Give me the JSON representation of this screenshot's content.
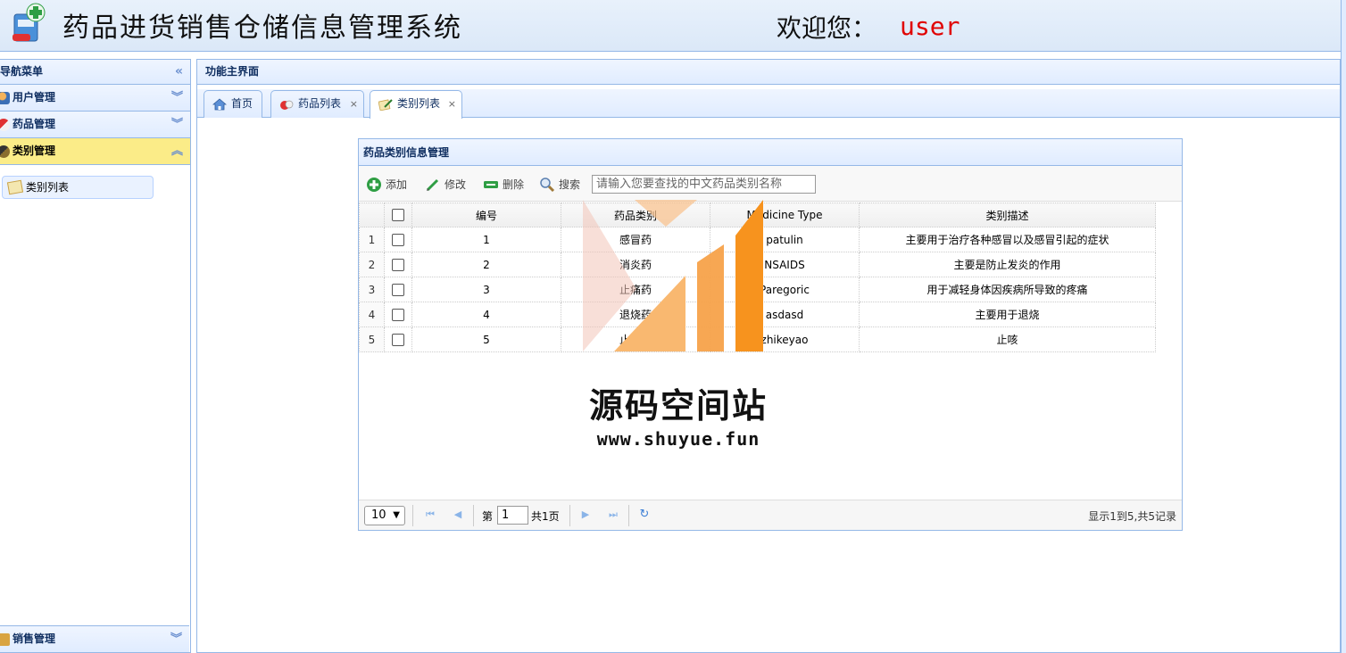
{
  "header": {
    "title": "药品进货销售仓储信息管理系统",
    "welcome": "欢迎您：",
    "username": "user"
  },
  "sidebar": {
    "title": "导航菜单",
    "sections": [
      {
        "label": "用户管理",
        "icon": "users-icon"
      },
      {
        "label": "药品管理",
        "icon": "pill-icon"
      },
      {
        "label": "类别管理",
        "icon": "category-icon"
      }
    ],
    "active_item": "类别列表",
    "bottom_section": "销售管理"
  },
  "main": {
    "title": "功能主界面",
    "tabs": [
      {
        "label": "首页",
        "icon": "home-icon"
      },
      {
        "label": "药品列表",
        "icon": "pill-icon"
      },
      {
        "label": "类别列表",
        "icon": "edit-icon"
      }
    ],
    "close_glyph": "×"
  },
  "grid": {
    "title": "药品类别信息管理",
    "toolbar": {
      "add": "添加",
      "edit": "修改",
      "delete": "删除",
      "search": "搜索",
      "search_placeholder": "请输入您要查找的中文药品类别名称"
    },
    "columns": [
      "编号",
      "药品类别",
      "Medicine Type",
      "类别描述"
    ],
    "rows": [
      {
        "n": "1",
        "id": "1",
        "category": "感冒药",
        "type": "patulin",
        "desc": "主要用于治疗各种感冒以及感冒引起的症状"
      },
      {
        "n": "2",
        "id": "2",
        "category": "消炎药",
        "type": "NSAIDS",
        "desc": "主要是防止发炎的作用"
      },
      {
        "n": "3",
        "id": "3",
        "category": "止痛药",
        "type": "Paregoric",
        "desc": "用于减轻身体因疾病所导致的疼痛"
      },
      {
        "n": "4",
        "id": "4",
        "category": "退烧药",
        "type": "asdasd",
        "desc": "主要用于退烧"
      },
      {
        "n": "5",
        "id": "5",
        "category": "止咳药",
        "type": "zhikeyao",
        "desc": "止咳"
      }
    ],
    "pager": {
      "page_size": "10",
      "page_prefix": "第",
      "page_number": "1",
      "page_total": "共1页",
      "info": "显示1到5,共5记录"
    }
  },
  "watermark": {
    "text": "源码空间站",
    "url": "www.shuyue.fun"
  },
  "colors": {
    "header_bg": "#dbe8f8",
    "border": "#95b8e7",
    "active_section": "#fbec88",
    "username": "#e00000",
    "watermark_orange": "#f7931e"
  }
}
